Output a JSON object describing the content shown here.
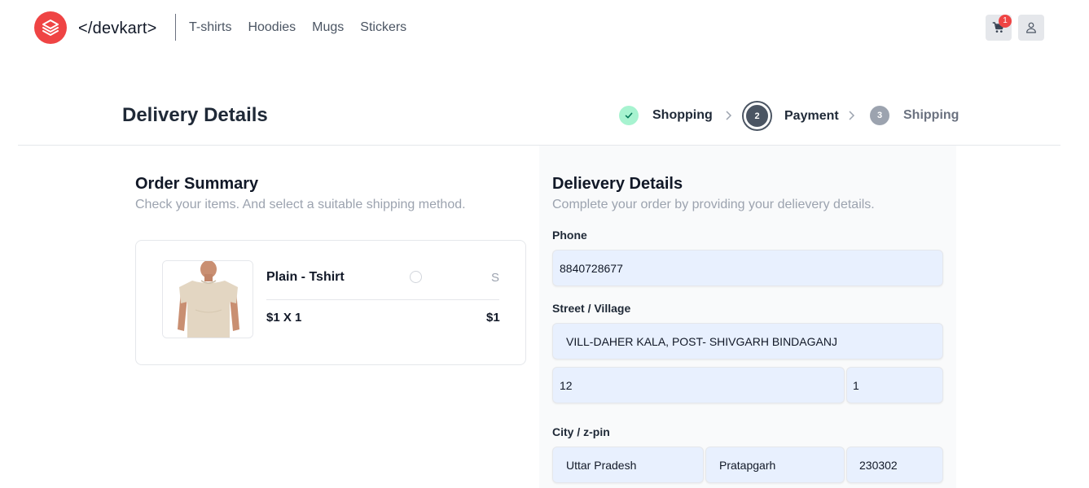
{
  "header": {
    "logo_text": "</devkart>",
    "nav": [
      "T-shirts",
      "Hoodies",
      "Mugs",
      "Stickers"
    ],
    "cart_count": "1",
    "icons": {
      "logo": "stack-layers-icon",
      "cart": "cart-icon",
      "user": "user-icon"
    }
  },
  "page": {
    "title": "Delivery Details"
  },
  "steps": [
    {
      "number": "",
      "label": "Shopping",
      "state": "done",
      "icon": "check-icon"
    },
    {
      "number": "2",
      "label": "Payment",
      "state": "current"
    },
    {
      "number": "3",
      "label": "Shipping",
      "state": "upcoming"
    }
  ],
  "order_summary": {
    "title": "Order Summary",
    "subtitle": "Check your items. And select a suitable shipping method.",
    "item": {
      "name": "Plain - Tshirt",
      "size": "S",
      "qty_text": "$1 X 1",
      "total": "$1"
    }
  },
  "delivery": {
    "title": "Delievery Details",
    "subtitle": "Complete your order by providing your delievery details.",
    "phone_label": "Phone",
    "phone": "8840728677",
    "street_label": "Street / Village",
    "street": "VILL-DAHER KALA, POST- SHIVGARH BINDAGANJ",
    "house": "12",
    "floor": "1",
    "city_label": "City / z-pin",
    "state": "Uttar Pradesh",
    "city": "Pratapgarh",
    "zip": "230302"
  },
  "colors": {
    "brand": "#ef4444",
    "step_done": "#a7f3d0",
    "step_current": "#4b5563",
    "step_upcoming": "#9ca3af",
    "field_bg": "#e8f0fe"
  }
}
